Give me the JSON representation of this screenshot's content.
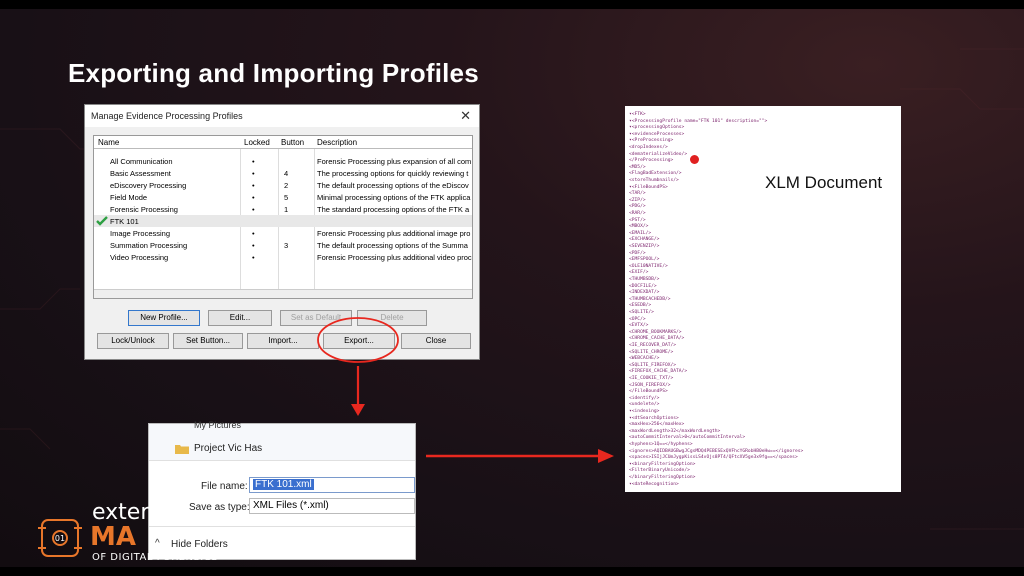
{
  "slide": {
    "title": "Exporting and Importing Profiles",
    "xlm_label": "XLM Document"
  },
  "dialog": {
    "title": "Manage Evidence Processing Profiles",
    "close": "✕",
    "columns": [
      "Name",
      "Locked",
      "Button",
      "Description"
    ],
    "rows": [
      {
        "name": "All Communication",
        "locked": "•",
        "button": "",
        "desc": "Forensic Processing plus expansion of all com"
      },
      {
        "name": "Basic Assessment",
        "locked": "•",
        "button": "4",
        "desc": "The processing options for quickly reviewing t"
      },
      {
        "name": "eDiscovery Processing",
        "locked": "•",
        "button": "2",
        "desc": "The default processing options of the eDiscov"
      },
      {
        "name": "Field Mode",
        "locked": "•",
        "button": "5",
        "desc": "Minimal processing options of the FTK applica"
      },
      {
        "name": "Forensic Processing",
        "locked": "•",
        "button": "1",
        "desc": "The standard processing options of the FTK a"
      },
      {
        "name": "FTK 101",
        "locked": "",
        "button": "",
        "desc": ""
      },
      {
        "name": "Image Processing",
        "locked": "•",
        "button": "",
        "desc": "Forensic Processing plus additional image pro"
      },
      {
        "name": "Summation Processing",
        "locked": "•",
        "button": "3",
        "desc": "The default processing options of the Summa"
      },
      {
        "name": "Video Processing",
        "locked": "•",
        "button": "",
        "desc": "Forensic Processing plus additional video proc"
      }
    ],
    "buttons": {
      "new_profile": "New Profile...",
      "edit": "Edit...",
      "set_default": "Set as Default",
      "delete": "Delete",
      "lock_unlock": "Lock/Unlock",
      "set_button": "Set Button...",
      "import": "Import...",
      "export": "Export...",
      "close": "Close"
    }
  },
  "save_dialog": {
    "folder_above": "My Pictures",
    "folder": "Project Vic Has",
    "file_name_label": "File name:",
    "file_name_value": "FTK 101.xml",
    "save_type_label": "Save as type:",
    "save_type_value": "XML Files (*.xml)",
    "hide_folders": "Hide Folders"
  },
  "xml_lines": [
    "▾<FTK>",
    " ▾<ProcessingProfile name=\"FTK 101\" description=\"\">",
    "  ▾<processingOptions>",
    "   ▾<evidenceProcesses>",
    "    ▾<PreProcessing>",
    "      <dropIndexes/>",
    "      <dematerializeVideo/>",
    "     </PreProcessing>",
    "     <MD5/>",
    "     <FlagBadExtension/>",
    "     <storeThumbnails/>",
    "    ▾<FileBoundPS>",
    "      <TAR/>",
    "      <ZIP/>",
    "      <PDG/>",
    "      <RAR/>",
    "      <PST/>",
    "      <MBOX/>",
    "      <EMAIL/>",
    "      <EXCHANGE/>",
    "      <SEVENZIP/>",
    "      <PDF/>",
    "      <EMFSPOOL/>",
    "      <OLE10NATIVE/>",
    "      <EXIF/>",
    "      <THUMBSDB/>",
    "      <DOCFILE/>",
    "      <INDEXDAT/>",
    "      <THUMBCACHEDB/>",
    "      <ESEDB/>",
    "      <SQLITE/>",
    "      <OPC/>",
    "      <EVTX/>",
    "      <CHROME_BOOKMARKS/>",
    "      <CHROME_CACHE_DATA/>",
    "      <IE_RECOVER_DAT/>",
    "      <SQLITE_CHROME/>",
    "      <WEBCACHE/>",
    "      <SQLITE_FIREFOX/>",
    "      <FIREFOX_CACHE_DATA/>",
    "      <IE_COOKIE_TXT/>",
    "      <JSON_FIREFOX/>",
    "     </FileBoundPS>",
    "     <identify/>",
    "     <undelete/>",
    "    ▾<indexing>",
    "     ▾<dtSearchOptions>",
    "        <maxHex>256</maxHex>",
    "        <maxWordLength>32</maxWordLength>",
    "        <autoCommitInterval>0</autoCommitInterval>",
    "        <hyphens>1Q==</hyphens>",
    "        <ignores>AQIDBAUGBwgJCgsMDQ4PEBESExQVFhcYGRobHB0eHw==</ignores>",
    "        <spaces>ISIjJCUmJygpKissLS4vOjs8PT4/QFtcXV5ge3x9fg==</spaces>",
    "       ▾<binaryFilteringOption>",
    "          <FilterBinaryUnicode/>",
    "        </binaryFilteringOption>",
    "     ▾<dateRecognition>"
  ],
  "logo": {
    "line1": "exter",
    "line2": "MA",
    "line3": "OF DIGITAL FORENSICS"
  }
}
